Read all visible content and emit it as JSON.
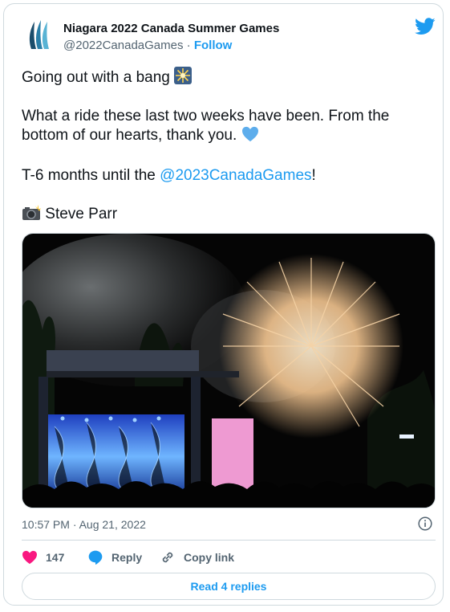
{
  "author": {
    "name": "Niagara 2022 Canada Summer Games",
    "handle": "@2022CanadaGames",
    "separator": " · ",
    "follow_label": "Follow",
    "avatar_icon": "niagara-waves-logo",
    "brand_color": "#1d9bf0"
  },
  "tweet": {
    "line1": "Going out with a bang",
    "line1_emoji": "sparkler-emoji",
    "line2a": "What a ride these last two weeks have been. From the",
    "line2b": "bottom of our hearts, thank you.",
    "line2_emoji": "blue-heart-emoji",
    "line3_prefix": "T-6 months until the ",
    "line3_mention": "@2023CanadaGames",
    "line3_suffix": "!",
    "line4_emoji": "camera-flash-emoji",
    "line4_text": "Steve Parr"
  },
  "media": {
    "icon": "fireworks-concert-photo"
  },
  "meta": {
    "timestamp": "10:57 PM · Aug 21, 2022"
  },
  "actions": {
    "like_count": "147",
    "reply_label": "Reply",
    "copy_link_label": "Copy link"
  },
  "read_replies_label": "Read 4 replies"
}
